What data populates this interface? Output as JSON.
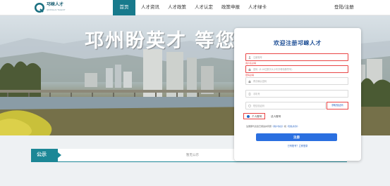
{
  "header": {
    "logo_text": "邛崃人才",
    "logo_subtext": "QIONGLAI TALENT",
    "nav": [
      {
        "label": "首页",
        "active": true
      },
      {
        "label": "人才资讯",
        "active": false
      },
      {
        "label": "人才政策",
        "active": false
      },
      {
        "label": "人才认定",
        "active": false
      },
      {
        "label": "政策申报",
        "active": false
      },
      {
        "label": "人才绿卡",
        "active": false
      }
    ],
    "login_label": "登陆/注册"
  },
  "hero": {
    "slogan": "邛州盼英才 等您"
  },
  "notice": {
    "label": "公示",
    "empty_text": "暂无公示"
  },
  "register": {
    "title": "欢迎注册邛崃人才",
    "fields": {
      "username": {
        "placeholder": "注册账号",
        "error": "用户名必填"
      },
      "password": {
        "placeholder": "密码（8-16位数字大小写字母特殊符号）",
        "error": "密码必填"
      },
      "confirm": {
        "placeholder": "再次确认密码"
      },
      "phone": {
        "placeholder": "手机号"
      },
      "code": {
        "placeholder": "短信验证码"
      }
    },
    "get_code_label": "获取验证码",
    "account_types": [
      {
        "label": "个人账号",
        "selected": true
      },
      {
        "label": "法人账号",
        "selected": false
      }
    ],
    "agreement_prefix": "注册即代表您已阅读并同意",
    "agreement_link1": "《用户协议》",
    "agreement_mid": "和",
    "agreement_link2": "《隐私条款》",
    "submit_label": "注册",
    "bottom_link": "已有账号？立即登录"
  },
  "colors": {
    "primary_teal": "#187a8c",
    "notice_teal": "#1c8796",
    "button_blue": "#2a6fe0",
    "title_blue": "#1e4f96",
    "error_red": "#e94545"
  }
}
